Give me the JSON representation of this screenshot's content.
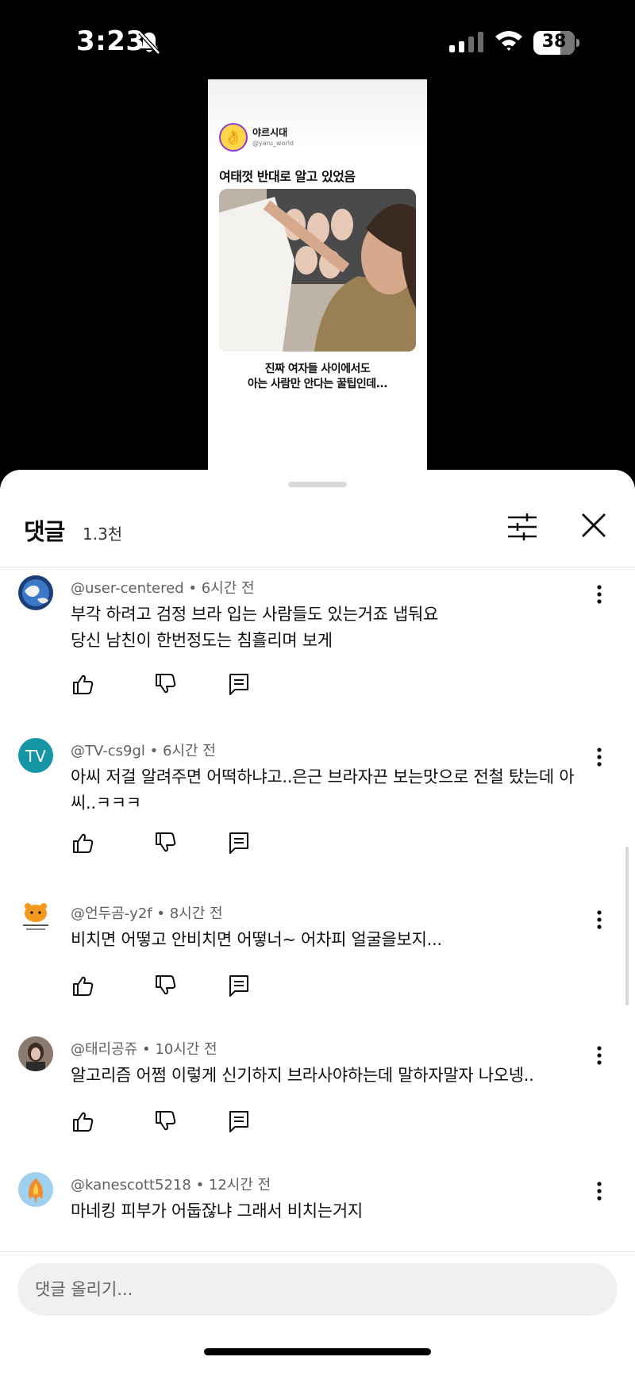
{
  "status": {
    "time": "3:23",
    "battery": "38"
  },
  "video": {
    "channel_name": "야르시대",
    "channel_handle": "@yaru_world",
    "title": "여태껏 반대로 알고 있었음",
    "caption_line1": "진짜 여자들 사이에서도",
    "caption_line2": "아는 사람만 안다는 꿀팁인데..."
  },
  "comments_header": {
    "title": "댓글",
    "count": "1.3천"
  },
  "comments": [
    {
      "author": "@user-centered",
      "time": "6시간 전",
      "text": "부각 하려고 검정 브라 입는 사람들도 있는거죠 냅둬요\n당신 남친이 한번정도는 침흘리며 보게",
      "avatar": "earth"
    },
    {
      "author": "@TV-cs9gl",
      "time": "6시간 전",
      "text": "아씨 저걸 알려주면 어떡하냐고..은근 브라자끈 보는맛으로 전철 탔는데 아씨..ㅋㅋㅋ",
      "avatar": "TV"
    },
    {
      "author": "@언두곰-y2f",
      "time": "8시간 전",
      "text": "비치면 어떻고 안비치면 어떻너~  어차피 얼굴을보지...",
      "avatar": "bear"
    },
    {
      "author": "@태리공쥬",
      "time": "10시간 전",
      "text": "알고리즘 어쩜 이렇게 신기하지 브라사야하는데 말하자말자 나오넹..",
      "avatar": "photo"
    },
    {
      "author": "@kanescott5218",
      "time": "12시간 전",
      "text": "마네킹 피부가 어둡잖냐 그래서 비치는거지",
      "avatar": "phoenix"
    }
  ],
  "input": {
    "placeholder": "댓글 올리기..."
  },
  "colors": {
    "tv_avatar": "#1596a5",
    "background": "#000000",
    "sheet": "#ffffff"
  }
}
